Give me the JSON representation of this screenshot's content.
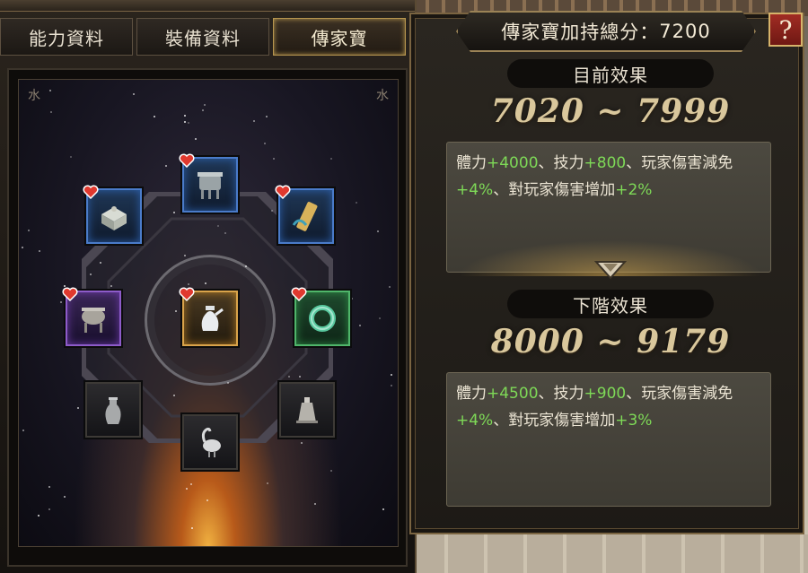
{
  "tabs": [
    {
      "label": "能力資料",
      "active": false
    },
    {
      "label": "裝備資料",
      "active": false
    },
    {
      "label": "傳家寶",
      "active": true
    }
  ],
  "score": {
    "label": "傳家寶加持總分：",
    "value": "7200"
  },
  "help": {
    "label": "?"
  },
  "current": {
    "title": "目前效果",
    "range": "7020 ~ 7999",
    "effects": [
      {
        "name": "體力",
        "value": "+4000"
      },
      {
        "name": "技力",
        "value": "+800"
      },
      {
        "name": "玩家傷害減免",
        "value": "+4%"
      },
      {
        "name": "對玩家傷害增加",
        "value": "+2%"
      }
    ]
  },
  "next": {
    "title": "下階效果",
    "range": "8000 ~ 9179",
    "effects": [
      {
        "name": "體力",
        "value": "+4500"
      },
      {
        "name": "技力",
        "value": "+900"
      },
      {
        "name": "玩家傷害減免",
        "value": "+4%"
      },
      {
        "name": "對玩家傷害增加",
        "value": "+3%"
      }
    ]
  },
  "board": {
    "corner_glyph": "水",
    "slots": [
      {
        "id": "top",
        "rarity": "blue",
        "icon": "bronze-ding-icon",
        "favorite": true
      },
      {
        "id": "upper-left",
        "rarity": "blue",
        "icon": "jade-box-icon",
        "favorite": true
      },
      {
        "id": "upper-right",
        "rarity": "blue",
        "icon": "bamboo-scroll-icon",
        "favorite": true
      },
      {
        "id": "left",
        "rarity": "purple",
        "icon": "tripod-cauldron-icon",
        "favorite": true
      },
      {
        "id": "center",
        "rarity": "gold",
        "icon": "porcelain-ewer-icon",
        "favorite": true
      },
      {
        "id": "right",
        "rarity": "green",
        "icon": "jade-bracelet-icon",
        "favorite": true
      },
      {
        "id": "lower-left",
        "rarity": "grey",
        "icon": "vase-icon",
        "favorite": false
      },
      {
        "id": "lower-right",
        "rarity": "grey",
        "icon": "bronze-bell-icon",
        "favorite": false
      },
      {
        "id": "bottom",
        "rarity": "grey",
        "icon": "crane-statue-icon",
        "favorite": false
      }
    ]
  },
  "colors": {
    "accent_gold": "#b7964f",
    "bonus_green": "#7ed957",
    "help_red": "#a12c24"
  }
}
